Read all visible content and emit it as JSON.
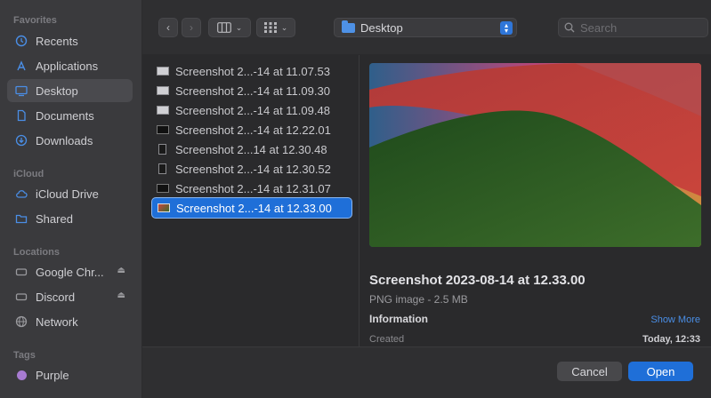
{
  "sidebar": {
    "sections": {
      "favorites": "Favorites",
      "icloud": "iCloud",
      "locations": "Locations",
      "tags": "Tags"
    },
    "favorites": [
      {
        "label": "Recents",
        "icon": "clock-icon"
      },
      {
        "label": "Applications",
        "icon": "applications-icon"
      },
      {
        "label": "Desktop",
        "icon": "desktop-icon"
      },
      {
        "label": "Documents",
        "icon": "document-icon"
      },
      {
        "label": "Downloads",
        "icon": "download-icon"
      }
    ],
    "icloud": [
      {
        "label": "iCloud Drive",
        "icon": "cloud-icon"
      },
      {
        "label": "Shared",
        "icon": "shared-folder-icon"
      }
    ],
    "locations": [
      {
        "label": "Google Chr...",
        "icon": "disk-icon"
      },
      {
        "label": "Discord",
        "icon": "disk-icon"
      },
      {
        "label": "Network",
        "icon": "globe-icon"
      }
    ],
    "tags": [
      {
        "label": "Purple",
        "color": "#a77bd1"
      }
    ]
  },
  "toolbar": {
    "path": "Desktop",
    "search_placeholder": "Search"
  },
  "files": [
    "Screenshot 2...-14 at 11.07.53",
    "Screenshot 2...-14 at 11.09.30",
    "Screenshot 2...-14 at 11.09.48",
    "Screenshot 2...-14 at 12.22.01",
    "Screenshot 2...14 at 12.30.48",
    "Screenshot 2...-14 at 12.30.52",
    "Screenshot 2...-14 at 12.31.07",
    "Screenshot 2...-14 at 12.33.00"
  ],
  "preview": {
    "name": "Screenshot 2023-08-14 at 12.33.00",
    "kind": "PNG image - 2.5 MB",
    "info_label": "Information",
    "show_more": "Show More",
    "created_label": "Created",
    "created_value": "Today, 12:33"
  },
  "buttons": {
    "cancel": "Cancel",
    "open": "Open"
  },
  "colors": {
    "accent": "#1f6fd8"
  }
}
